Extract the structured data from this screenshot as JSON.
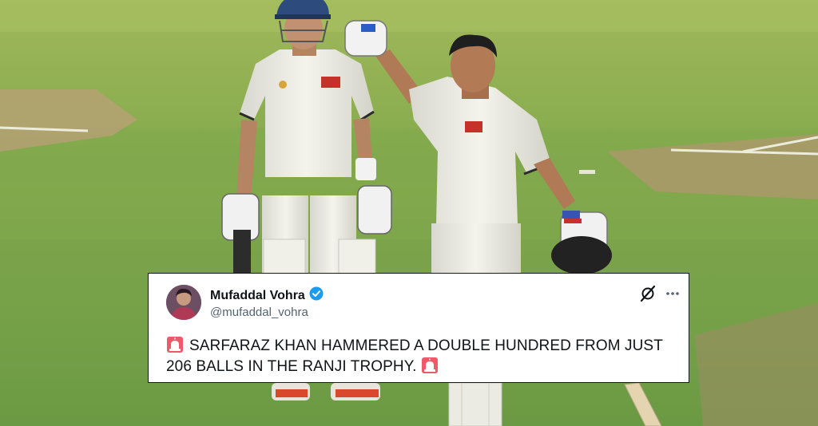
{
  "tweet": {
    "author_name": "Mufaddal Vohra",
    "author_handle": "@mufaddal_vohra",
    "text_line1": "SARFARAZ KHAN HAMMERED A DOUBLE HUNDRED FROM JUST",
    "text_line2": "206 BALLS IN THE RANJI TROPHY.",
    "verified_color": "#1d9bf0",
    "icons": [
      "siren-emoji-icon",
      "verified-badge-icon",
      "grok-icon",
      "more-options-icon"
    ]
  },
  "colors": {
    "field_green": "#7ea64a",
    "pitch_brown": "#b59368",
    "kit_white": "#ecebe3"
  }
}
